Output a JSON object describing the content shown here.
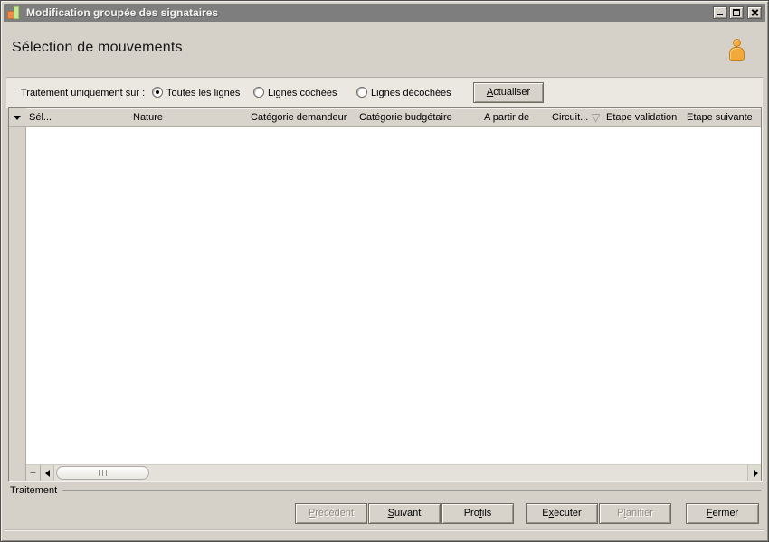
{
  "window": {
    "title": "Modification groupée des signataires",
    "controls": {
      "minimize": "minimize",
      "maximize": "maximize",
      "close": "close"
    }
  },
  "header": {
    "title": "Sélection de mouvements",
    "user_icon": "orange-person"
  },
  "filter_bar": {
    "label": "Traitement uniquement sur :",
    "options": [
      {
        "label": "Toutes les lignes",
        "selected": true
      },
      {
        "label": "Lignes cochées",
        "selected": false
      },
      {
        "label": "Lignes décochées",
        "selected": false
      }
    ],
    "refresh_button": {
      "pre": "",
      "mn": "A",
      "post": "ctualiser",
      "enabled": true
    }
  },
  "table": {
    "columns": [
      "Sél...",
      "Nature",
      "Catégorie demandeur",
      "Catégorie budgétaire",
      "A partir de",
      "Circuit...",
      "Etape validation",
      "Etape suivante"
    ],
    "filter_icon_glyph": "▽",
    "rows": [],
    "add_button_label": "+"
  },
  "footer": {
    "group_label": "Traitement",
    "buttons": [
      {
        "pre": "",
        "mn": "P",
        "post": "récédent",
        "enabled": false
      },
      {
        "pre": "",
        "mn": "S",
        "post": "uivant",
        "enabled": true
      },
      {
        "pre": "Pro",
        "mn": "f",
        "post": "ils",
        "enabled": true
      },
      {
        "pre": "E",
        "mn": "x",
        "post": "écuter",
        "enabled": true
      },
      {
        "pre": "P",
        "mn": "l",
        "post": "anifier",
        "enabled": false
      },
      {
        "pre": "",
        "mn": "F",
        "post": "ermer",
        "enabled": true
      }
    ]
  },
  "colors": {
    "titlebar": "#7e7e7e",
    "background": "#d5d1c8",
    "filter_band": "#ebe8e2",
    "grid_header": "#d8d4cc",
    "accent_orange": "#f2a93b",
    "icon_green": "#c6e994",
    "icon_orange": "#f08a4b"
  }
}
